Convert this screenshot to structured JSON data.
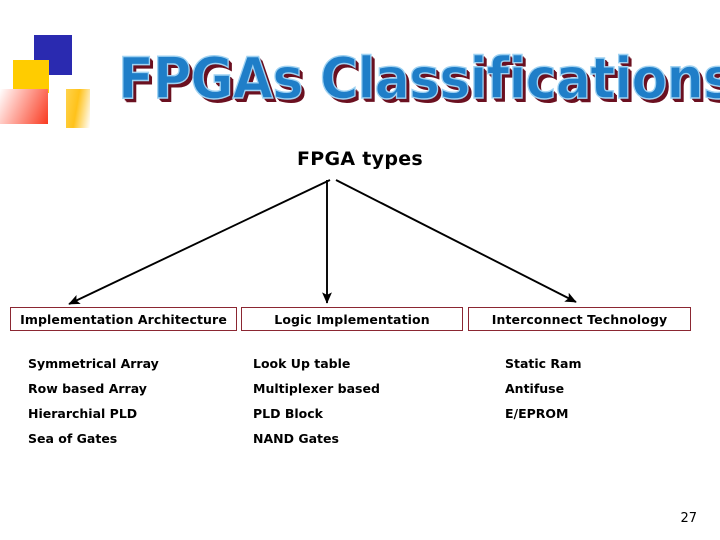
{
  "slide": {
    "title": "FPGAs Classifications",
    "heading": "FPGA types",
    "page_number": "27",
    "colors": {
      "title_fill": "#1f7ec8",
      "title_outline": "#9fd2f2",
      "title_shadow": "#6b1020",
      "box_border": "#8b2732",
      "arrow": "#000000",
      "logo_blue": "#2a2ab0",
      "logo_yellow": "#ffcc00",
      "logo_red": "#f93a20"
    }
  },
  "logo": {
    "blocks": [
      {
        "name": "blue-square"
      },
      {
        "name": "yellow-square"
      },
      {
        "name": "red-gradient-square"
      },
      {
        "name": "yellow-gradient-bar"
      }
    ]
  },
  "columns": [
    {
      "header": "Implementation Architecture",
      "items": [
        "Symmetrical Array",
        "Row based Array",
        "Hierarchial PLD",
        "Sea of Gates"
      ]
    },
    {
      "header": "Logic Implementation",
      "items": [
        "Look Up table",
        "Multiplexer based",
        "PLD Block",
        "NAND Gates"
      ]
    },
    {
      "header": "Interconnect Technology",
      "items": [
        "Static Ram",
        "Antifuse",
        "E/EPROM"
      ]
    }
  ],
  "connectors": [
    {
      "name": "arrow-to-implementation-architecture"
    },
    {
      "name": "arrow-to-logic-implementation"
    },
    {
      "name": "arrow-to-interconnect-technology"
    }
  ]
}
